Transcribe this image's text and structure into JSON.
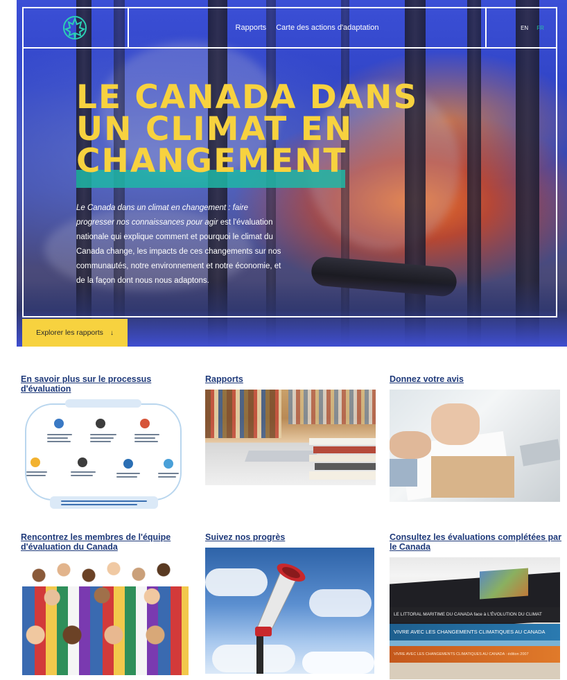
{
  "header": {
    "nav": [
      "Rapports",
      "Carte des actions d'adaptation"
    ],
    "lang_en": "EN",
    "lang_fr": "FR"
  },
  "hero": {
    "title_lines": [
      "LE CANADA DANS",
      "UN CLIMAT EN",
      "CHANGEMENT"
    ],
    "desc_italic": "Le Canada dans un climat en changement : faire progresser nos connaissances pour agir",
    "desc_rest": " est l'évaluation nationale qui explique comment et pourquoi le climat du Canada change, les impacts de ces changements sur nos communautés, notre environnement et notre économie, et de la façon dont nous nous adaptons.",
    "button_label": "Explorer les rapports",
    "button_icon": "arrow-down-icon"
  },
  "cards": [
    {
      "title": "En savoir plus sur le processus d'évaluation"
    },
    {
      "title": "Rapports"
    },
    {
      "title": "Donnez votre avis"
    },
    {
      "title": "Rencontrez les membres de l'équipe d'évaluation du Canada"
    },
    {
      "title": "Suivez nos progrès"
    },
    {
      "title": "Consultez les évaluations complétées par le Canada"
    }
  ],
  "books": {
    "spine_1": "LE LITTORAL MARITIME DU CANADA face à L'ÉVOLUTION DU CLIMAT",
    "spine_2": "VIVRE AVEC LES CHANGEMENTS CLIMATIQUES AU CANADA",
    "spine_3": "VIVRE AVEC LES CHANGEMENTS CLIMATIQUES AU CANADA : édition 2007"
  },
  "colors": {
    "hero_blue": "#3b4fd6",
    "accent_yellow": "#f7d23f",
    "accent_teal": "#1fb7a6",
    "link_navy": "#1f3a7a"
  }
}
